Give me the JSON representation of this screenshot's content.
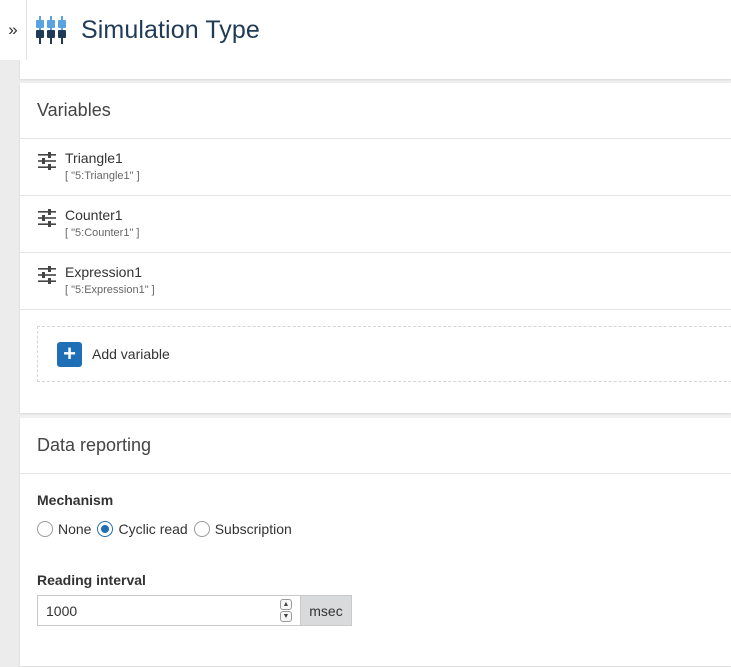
{
  "header": {
    "expand_glyph": "»",
    "title": "Simulation Type",
    "icon": "simulation-icon"
  },
  "variables_card": {
    "title": "Variables",
    "items": [
      {
        "name": "Triangle1",
        "id": "[ \"5:Triangle1\" ]",
        "icon": "sliders-icon"
      },
      {
        "name": "Counter1",
        "id": "[ \"5:Counter1\" ]",
        "icon": "sliders-icon"
      },
      {
        "name": "Expression1",
        "id": "[ \"5:Expression1\" ]",
        "icon": "sliders-icon"
      }
    ],
    "add_label": "Add variable",
    "add_glyph": "+"
  },
  "reporting_card": {
    "title": "Data reporting",
    "mechanism_label": "Mechanism",
    "mechanism_options": [
      "None",
      "Cyclic read",
      "Subscription"
    ],
    "mechanism_selected": "Cyclic read",
    "interval_label": "Reading interval",
    "interval_value": "1000",
    "interval_unit": "msec"
  },
  "colors": {
    "accent": "#1f6fb6",
    "title_text": "#1f3b57",
    "icon_light_blue": "#5ba3e0",
    "icon_dark": "#1f3b57"
  }
}
